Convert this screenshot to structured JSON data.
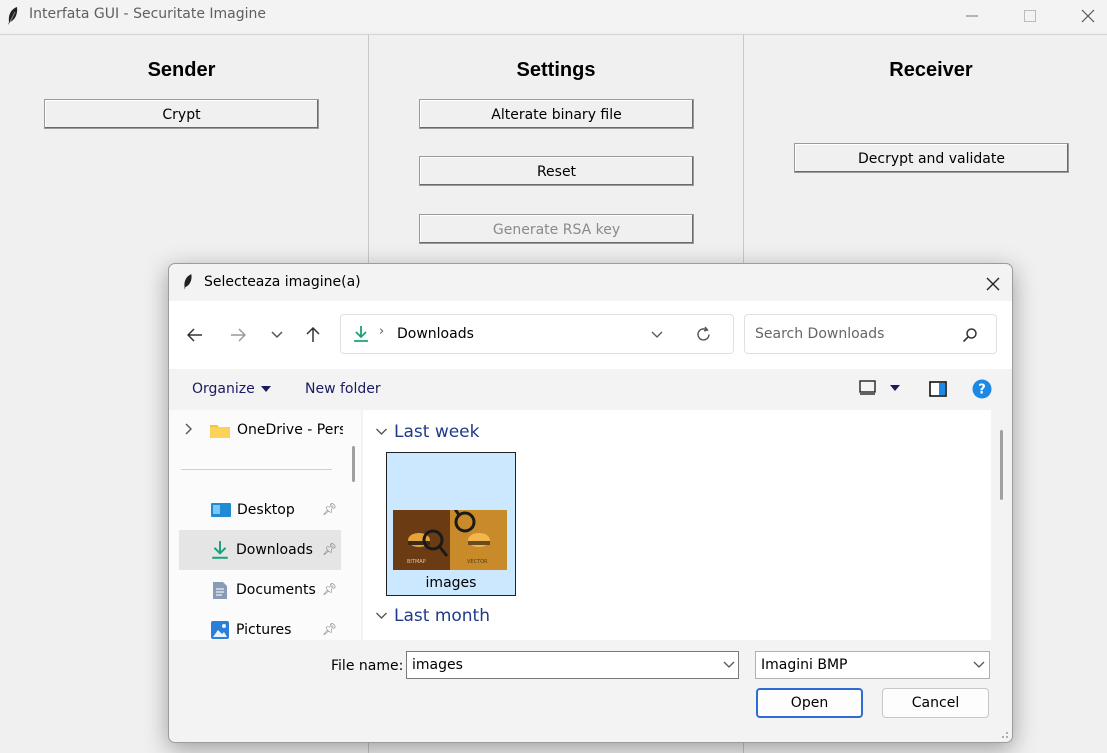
{
  "window": {
    "title": "Interfata GUI - Securitate Imagine",
    "controls": [
      "minimize-icon",
      "maximize-icon",
      "close-icon"
    ]
  },
  "panels": {
    "sender": {
      "title": "Sender",
      "buttons": [
        "Crypt"
      ]
    },
    "settings": {
      "title": "Settings",
      "buttons": [
        "Alterate binary file",
        "Reset",
        "Generate RSA key"
      ]
    },
    "receiver": {
      "title": "Receiver",
      "buttons": [
        "Decrypt and validate"
      ]
    }
  },
  "dialog": {
    "title": "Selecteaza imagine(a)",
    "address": {
      "location": "Downloads"
    },
    "search": {
      "placeholder": "Search Downloads"
    },
    "toolbar": {
      "organize": "Organize",
      "new_folder": "New folder"
    },
    "nav_pane": [
      {
        "label": "OneDrive - Personal",
        "icon": "folder-icon",
        "expandable": true
      },
      {
        "label": "Desktop",
        "icon": "desktop-icon",
        "pinned": true
      },
      {
        "label": "Downloads",
        "icon": "download-icon",
        "pinned": true,
        "selected": true
      },
      {
        "label": "Documents",
        "icon": "document-icon",
        "pinned": true
      },
      {
        "label": "Pictures",
        "icon": "pictures-icon",
        "pinned": true
      }
    ],
    "groups": [
      {
        "label": "Last week",
        "items": [
          {
            "name": "images",
            "icon": "image-folder-thumbnail",
            "thumb_labels": [
              "BITMAP",
              "VECTOR"
            ]
          }
        ]
      },
      {
        "label": "Last month",
        "items": []
      }
    ],
    "file_name_label": "File name:",
    "file_name_value": "images",
    "file_type": "Imagini BMP",
    "open_label": "Open",
    "cancel_label": "Cancel"
  },
  "colors": {
    "accent": "#0067c0",
    "help": "#1e88e5",
    "selection": "#cce8ff",
    "group_heading": "#1e3a8a"
  }
}
